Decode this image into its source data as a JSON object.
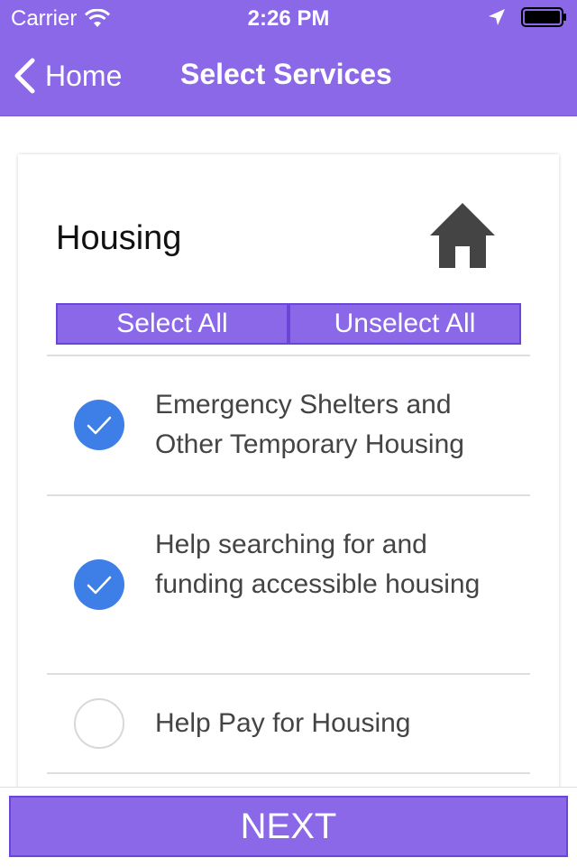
{
  "status_bar": {
    "carrier": "Carrier",
    "time": "2:26 PM",
    "icons": [
      "wifi-icon",
      "location-arrow-icon",
      "battery-icon"
    ]
  },
  "nav": {
    "back_label": "Home",
    "back_icon": "chevron-left-icon",
    "title": "Select Services"
  },
  "card": {
    "title": "Housing",
    "icon": "house-icon",
    "select_all_label": "Select All",
    "unselect_all_label": "Unselect All",
    "items": [
      {
        "label": "Emergency Shelters and Other Temporary Housing",
        "checked": true
      },
      {
        "label": "Help searching for and funding accessible housing",
        "checked": true
      },
      {
        "label": "Help Pay for Housing",
        "checked": false
      }
    ]
  },
  "footer": {
    "next_label": "NEXT"
  },
  "colors": {
    "brand_purple": "#8a68e8",
    "button_border": "#6a45d8",
    "check_blue": "#3d7fe6",
    "divider": "#dedede"
  }
}
